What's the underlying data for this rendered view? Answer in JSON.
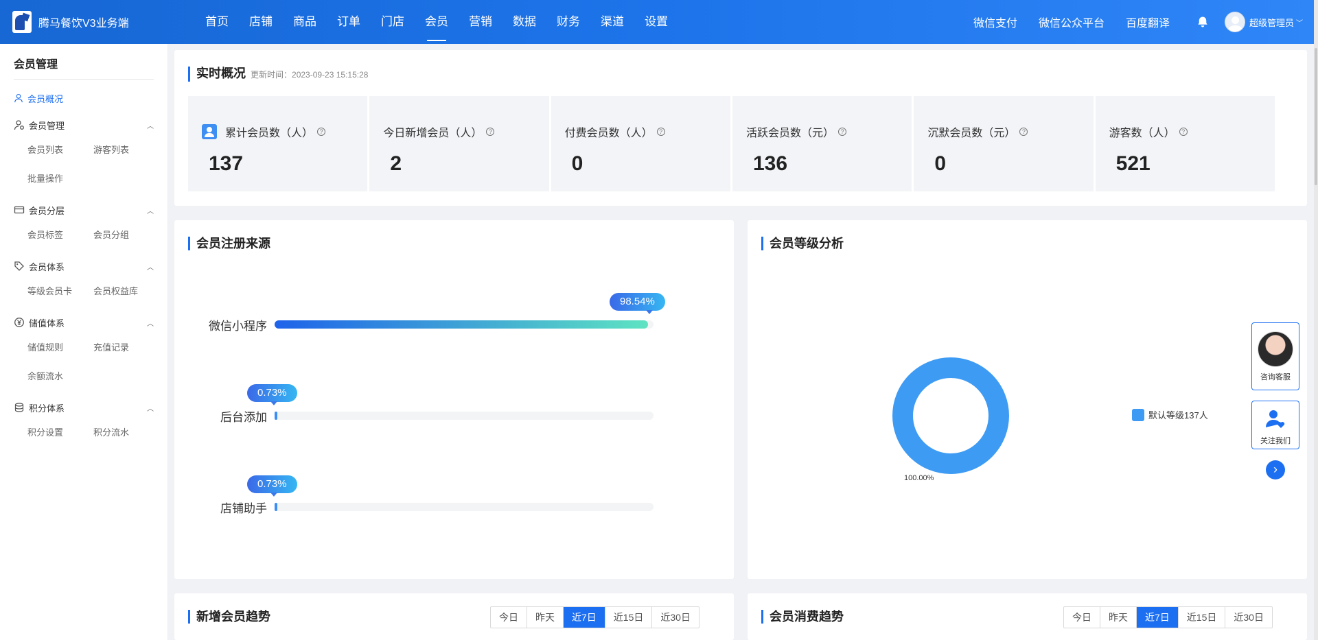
{
  "app": {
    "title": "腾马餐饮V3业务端"
  },
  "nav": {
    "items": [
      "首页",
      "店铺",
      "商品",
      "订单",
      "门店",
      "会员",
      "营销",
      "数据",
      "财务",
      "渠道",
      "设置"
    ],
    "active_index": 5,
    "links": [
      "微信支付",
      "微信公众平台",
      "百度翻译"
    ],
    "user": "超级管理员"
  },
  "sidebar": {
    "title": "会员管理",
    "overview": "会员概况",
    "groups": [
      {
        "label": "会员管理",
        "icon": "member-icon",
        "items": [
          "会员列表",
          "游客列表",
          "批量操作"
        ]
      },
      {
        "label": "会员分层",
        "icon": "card-icon",
        "items": [
          "会员标签",
          "会员分组"
        ]
      },
      {
        "label": "会员体系",
        "icon": "tag-icon",
        "items": [
          "等级会员卡",
          "会员权益库"
        ]
      },
      {
        "label": "储值体系",
        "icon": "yen-icon",
        "items": [
          "储值规则",
          "充值记录",
          "余额流水"
        ]
      },
      {
        "label": "积分体系",
        "icon": "coins-icon",
        "items": [
          "积分设置",
          "积分流水"
        ]
      }
    ]
  },
  "overview": {
    "title": "实时概况",
    "updated": "更新时间：2023-09-23 15:15:28",
    "stats": [
      {
        "label": "累计会员数（人）",
        "value": "137"
      },
      {
        "label": "今日新增会员（人）",
        "value": "2"
      },
      {
        "label": "付费会员数（人）",
        "value": "0"
      },
      {
        "label": "活跃会员数（元）",
        "value": "136"
      },
      {
        "label": "沉默会员数（元）",
        "value": "0"
      },
      {
        "label": "游客数（人）",
        "value": "521"
      }
    ]
  },
  "registration": {
    "title": "会员注册来源",
    "sources": [
      {
        "label": "微信小程序",
        "percent": 98.54,
        "percent_text": "98.54%"
      },
      {
        "label": "后台添加",
        "percent": 0.73,
        "percent_text": "0.73%"
      },
      {
        "label": "店铺助手",
        "percent": 0.73,
        "percent_text": "0.73%"
      }
    ]
  },
  "level": {
    "title": "会员等级分析",
    "legend": "默认等级137人",
    "percent_label": "100.00%",
    "color": "#3d9bf4"
  },
  "floats": {
    "service": "咨询客服",
    "follow": "关注我们"
  },
  "trend_new": {
    "title": "新增会员趋势",
    "tabs": [
      "今日",
      "昨天",
      "近7日",
      "近15日",
      "近30日"
    ],
    "active": 2
  },
  "trend_spend": {
    "title": "会员消费趋势",
    "tabs": [
      "今日",
      "昨天",
      "近7日",
      "近15日",
      "近30日"
    ],
    "active": 2
  },
  "colors": {
    "primary": "#1d6ff1",
    "header": "#1d74ea"
  }
}
